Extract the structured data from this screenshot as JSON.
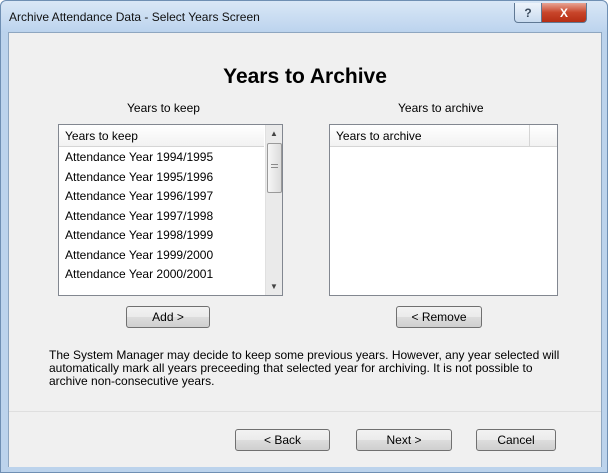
{
  "window": {
    "title": "Archive Attendance Data - Select Years Screen",
    "help_label": "?",
    "close_label": "X"
  },
  "heading": "Years to Archive",
  "keep": {
    "label": "Years to keep",
    "header": "Years to keep",
    "items": [
      "Attendance Year 1994/1995",
      "Attendance Year 1995/1996",
      "Attendance Year 1996/1997",
      "Attendance Year 1997/1998",
      "Attendance Year 1998/1999",
      "Attendance Year 1999/2000",
      "Attendance Year 2000/2001"
    ]
  },
  "archive": {
    "label": "Years to archive",
    "header": "Years to archive",
    "items": []
  },
  "buttons": {
    "add": "Add >",
    "remove": "< Remove",
    "back": "< Back",
    "next": "Next >",
    "cancel": "Cancel"
  },
  "info_text": "The System Manager may decide to keep some previous years. However, any year selected will automatically mark all years preceeding that selected year for archiving. It is not possible to archive non-consecutive years.",
  "colors": {
    "window_frame": "#bcd3ec",
    "close_button": "#c8452a",
    "client_background": "#f0f0f0"
  }
}
